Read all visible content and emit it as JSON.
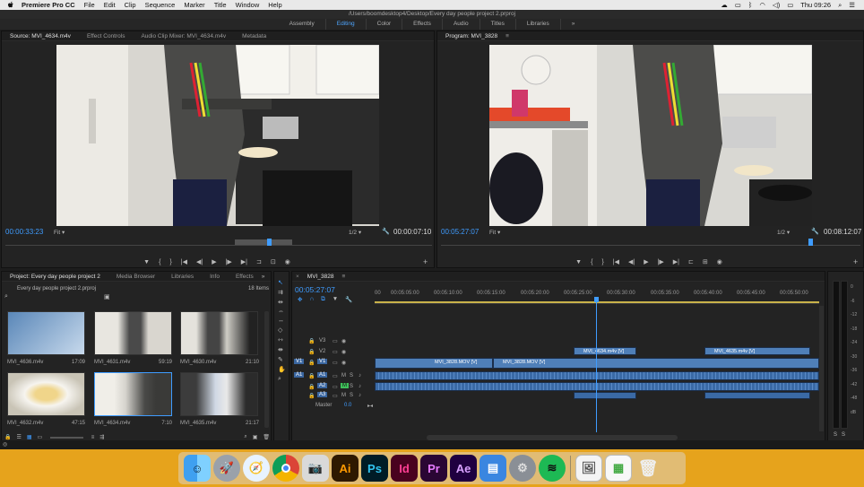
{
  "menubar": {
    "app_name": "Premiere Pro CC",
    "items": [
      "File",
      "Edit",
      "Clip",
      "Sequence",
      "Marker",
      "Title",
      "Window",
      "Help"
    ],
    "clock": "Thu 09:26"
  },
  "window": {
    "title": "/Users/boomdesktop4/Desktop/Every day people project 2.prproj",
    "workspaces": [
      "Assembly",
      "Editing",
      "Color",
      "Effects",
      "Audio",
      "Titles",
      "Libraries"
    ],
    "active_workspace": "Editing"
  },
  "source_monitor": {
    "tabs": [
      "Source: MVI_4634.m4v",
      "Effect Controls",
      "Audio Clip Mixer: MVI_4634.m4v",
      "Metadata"
    ],
    "timecode_left": "00:00:33:23",
    "fit": "Fit",
    "resolution": "1/2",
    "timecode_right": "00:00:07:10"
  },
  "program_monitor": {
    "tab": "Program: MVI_3828",
    "timecode_left": "00:05:27:07",
    "fit": "Fit",
    "resolution": "1/2",
    "timecode_right": "00:08:12:07"
  },
  "project_panel": {
    "tabs": [
      "Project: Every day people project 2",
      "Media Browser",
      "Libraries",
      "Info",
      "Effects"
    ],
    "path": "Every day people project 2.prproj",
    "item_count": "18 Items",
    "items": [
      {
        "name": "MVI_4636.m4v",
        "duration": "17:09"
      },
      {
        "name": "MVI_4631.m4v",
        "duration": "59:19"
      },
      {
        "name": "MVI_4630.m4v",
        "duration": "21:10"
      },
      {
        "name": "MVI_4632.m4v",
        "duration": "47:15"
      },
      {
        "name": "MVI_4634.m4v",
        "duration": "7:10"
      },
      {
        "name": "MVI_4635.m4v",
        "duration": "21:17"
      }
    ]
  },
  "timeline": {
    "tab": "MVI_3828",
    "timecode": "00:05:27:07",
    "ruler": [
      "00:05:05:00",
      "00:05:10:00",
      "00:05:15:00",
      "00:05:20:00",
      "00:05:25:00",
      "00:05:30:00",
      "00:05:35:00",
      "00:05:40:00",
      "00:05:45:00",
      "00:05:50:00"
    ],
    "ruler_first": "00",
    "tracks": {
      "v3": "V3",
      "v2": "V2",
      "v1": "V1",
      "a1": "A1",
      "a2": "A2",
      "a3": "A3",
      "master": "Master",
      "master_value": "0.0"
    },
    "clips": {
      "v1_a": "MVI_3828.MOV [V]",
      "v1_b": "MVI_3828.MOV [V]",
      "v2_a": "MVI_4634.m4v [V]",
      "v2_b": "MVI_4635.m4v [V]"
    }
  },
  "meters": {
    "labels": [
      "0",
      "-6",
      "-12",
      "-18",
      "-24",
      "-30",
      "-36",
      "-42",
      "-48",
      "dB"
    ],
    "solo": [
      "S",
      "S"
    ]
  },
  "dock": {
    "apps": [
      "Ai",
      "Ps",
      "Id",
      "Pr",
      "Ae"
    ]
  }
}
